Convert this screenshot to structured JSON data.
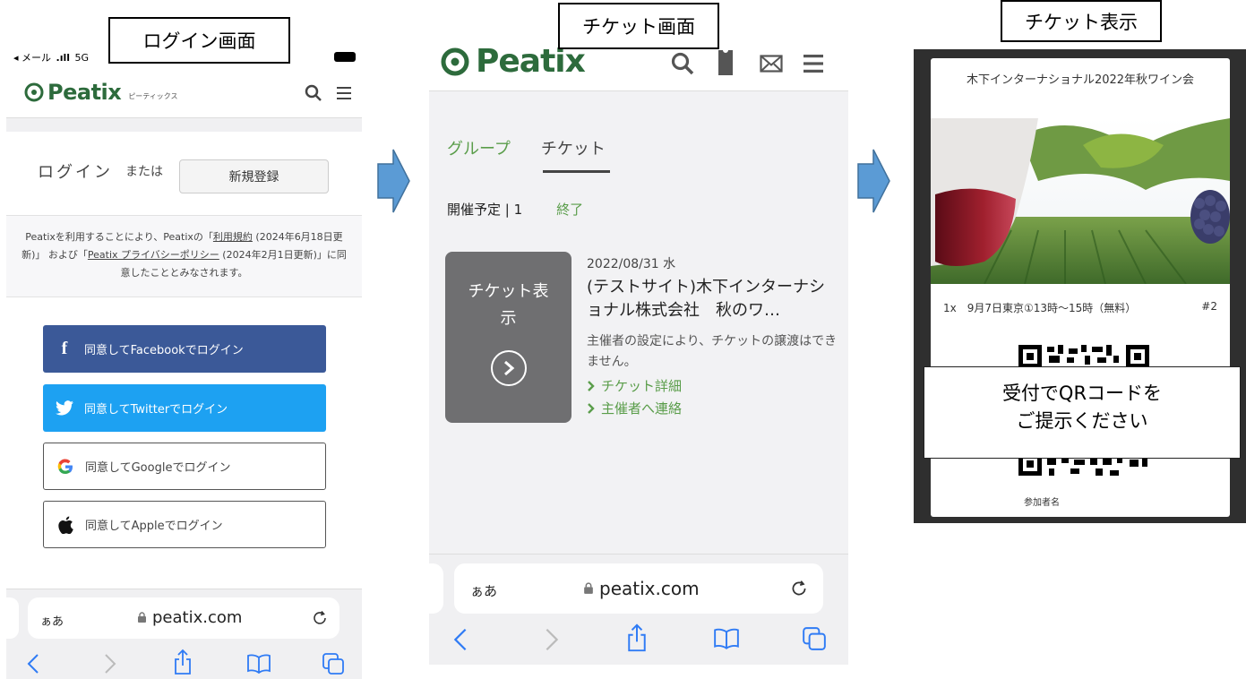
{
  "labels": {
    "login_screen": "ログイン画面",
    "ticket_screen": "チケット画面",
    "ticket_display": "チケット表示"
  },
  "login_panel": {
    "status_bar": {
      "carrier": "◂ メール",
      "network": "5G"
    },
    "logo_text": "Peatix",
    "logo_sub": "ピーティックス",
    "login_label": "ログイン",
    "or_label": "または",
    "register_button": "新規登録",
    "terms": {
      "part1": "Peatixを利用することにより、Peatixの「",
      "terms_link": "利用規約",
      "part2": " (2024年6月18日更新)」 および「",
      "privacy_link": "Peatix プライバシーポリシー",
      "part3": " (2024年2月1日更新)」に同意したこととみなされます。"
    },
    "sso_buttons": {
      "facebook": "同意してFacebookでログイン",
      "twitter": "同意してTwitterでログイン",
      "google": "同意してGoogleでログイン",
      "apple": "同意してAppleでログイン"
    },
    "address_bar": {
      "aa": "ぁあ",
      "url": "peatix.com"
    }
  },
  "ticket_panel": {
    "logo_text": "Peatix",
    "tabs": {
      "group": "グループ",
      "ticket": "チケット"
    },
    "filter": {
      "upcoming": "開催予定 | 1",
      "ended": "終了"
    },
    "ticket_card_label": "チケット表示",
    "event": {
      "date": "2022/08/31 水",
      "title": "(テストサイト)木下インターナショナル株式会社　秋のワ…",
      "note": "主催者の設定により、チケットの譲渡はできません。",
      "detail_link": "チケット詳細",
      "contact_link": "主催者へ連絡"
    },
    "address_bar": {
      "aa": "ぁあ",
      "url": "peatix.com"
    }
  },
  "display_panel": {
    "event_title": "木下インターナショナル2022年秋ワイン会",
    "ticket_line": {
      "left": "1x　9月7日東京①13時～15時（無料）",
      "right": "#2"
    },
    "attendee_label": "参加者名",
    "overlay_text": {
      "line1": "受付でQRコードを",
      "line2": "ご提示ください"
    }
  },
  "colors": {
    "peatix_green": "#2d6b3c",
    "tab_green": "#5a9d4a",
    "facebook": "#3b5998",
    "twitter": "#1da1f2",
    "arrow_blue": "#5b9bd5"
  }
}
